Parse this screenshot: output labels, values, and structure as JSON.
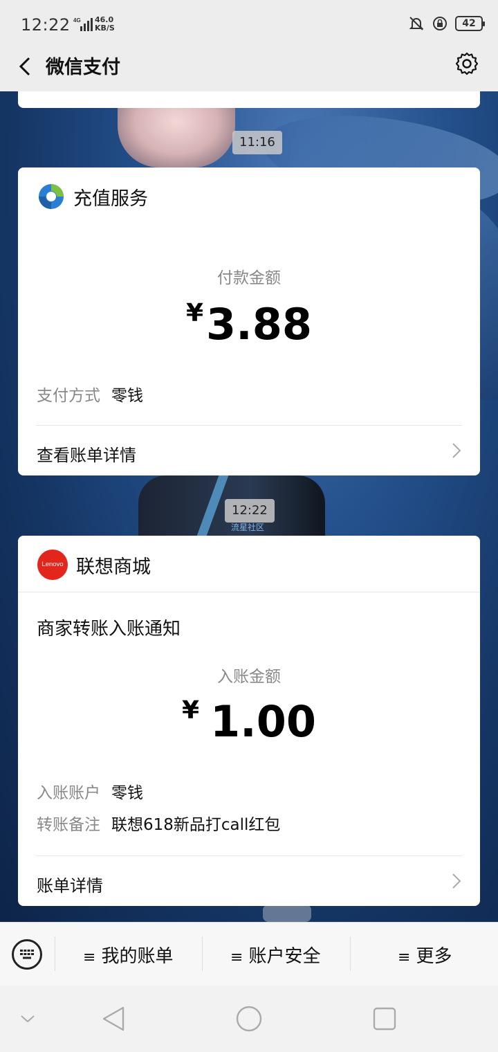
{
  "status_bar": {
    "time": "12:22",
    "network": "4G",
    "speed_value": "46.0",
    "speed_unit": "KB/S",
    "battery": "42"
  },
  "nav": {
    "title": "微信支付"
  },
  "messages": [
    {
      "timestamp": "11:16",
      "service_name": "充值服务",
      "amount_label": "付款金额",
      "currency": "¥",
      "amount": "3.88",
      "details": [
        {
          "key": "支付方式",
          "value": "零钱"
        }
      ],
      "link_label": "查看账单详情"
    },
    {
      "timestamp": "12:22",
      "watermark": "流星社区",
      "service_name": "联想商城",
      "logo_text": "Lenovo",
      "subtitle": "商家转账入账通知",
      "amount_label": "入账金额",
      "currency": "¥",
      "amount": "1.00",
      "details": [
        {
          "key": "入账账户",
          "value": "零钱"
        },
        {
          "key": "转账备注",
          "value": "联想618新品打call红包"
        }
      ],
      "link_label": "账单详情"
    }
  ],
  "bottom_menu": {
    "items": [
      {
        "label": "我的账单"
      },
      {
        "label": "账户安全"
      },
      {
        "label": "更多"
      }
    ],
    "menu_glyph": "≡"
  },
  "colors": {
    "accent_lenovo": "#e2261c",
    "background": "#1b3a66",
    "bar": "#ededed"
  }
}
